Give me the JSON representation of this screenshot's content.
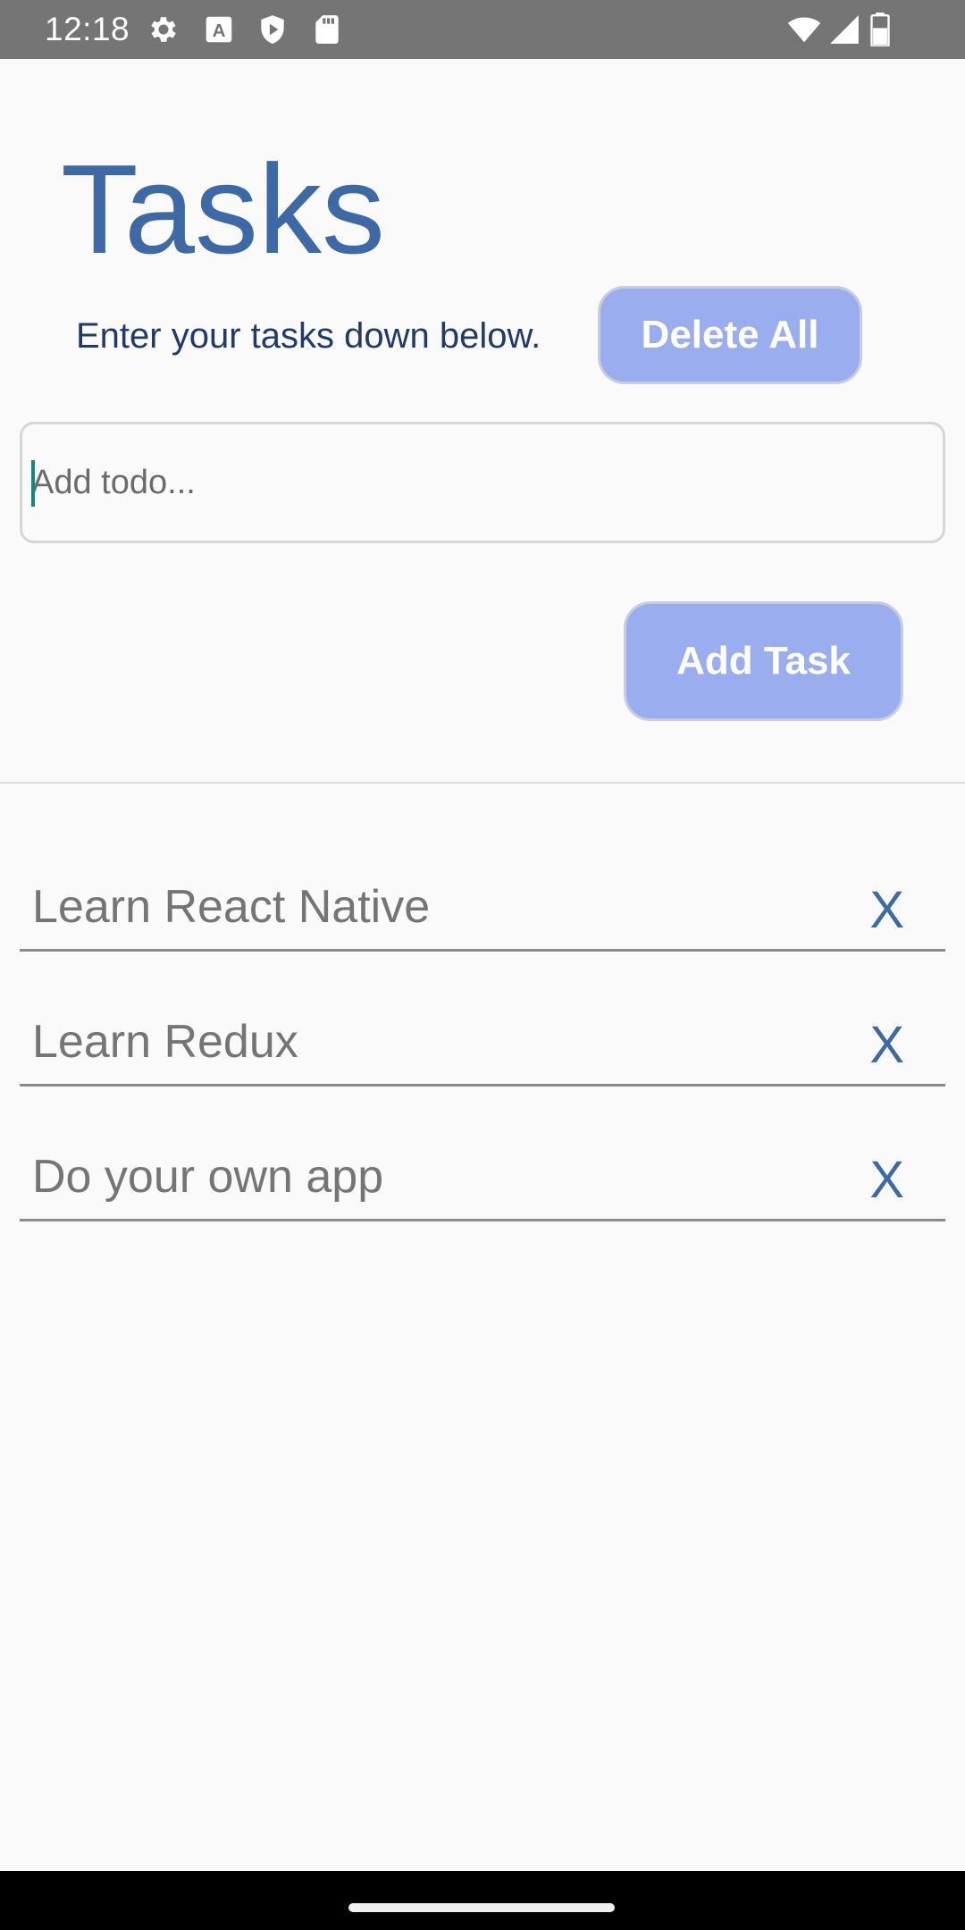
{
  "status_bar": {
    "time": "12:18",
    "icons": [
      "gear-icon",
      "a-icon",
      "shield-icon",
      "sd-card-icon",
      "wifi-icon",
      "signal-icon",
      "battery-icon"
    ]
  },
  "header": {
    "title": "Tasks",
    "subtitle": "Enter your tasks down below.",
    "delete_all_label": "Delete All"
  },
  "input": {
    "placeholder": "Add todo...",
    "value": ""
  },
  "add_task_label": "Add Task",
  "tasks": [
    {
      "text": "Learn React Native",
      "delete_label": "X"
    },
    {
      "text": "Learn Redux",
      "delete_label": "X"
    },
    {
      "text": "Do your own app",
      "delete_label": "X"
    }
  ],
  "colors": {
    "accent": "#3d6aa7",
    "button": "#9aaeef",
    "status_bar": "#757575",
    "caret": "#0f8a7a"
  }
}
